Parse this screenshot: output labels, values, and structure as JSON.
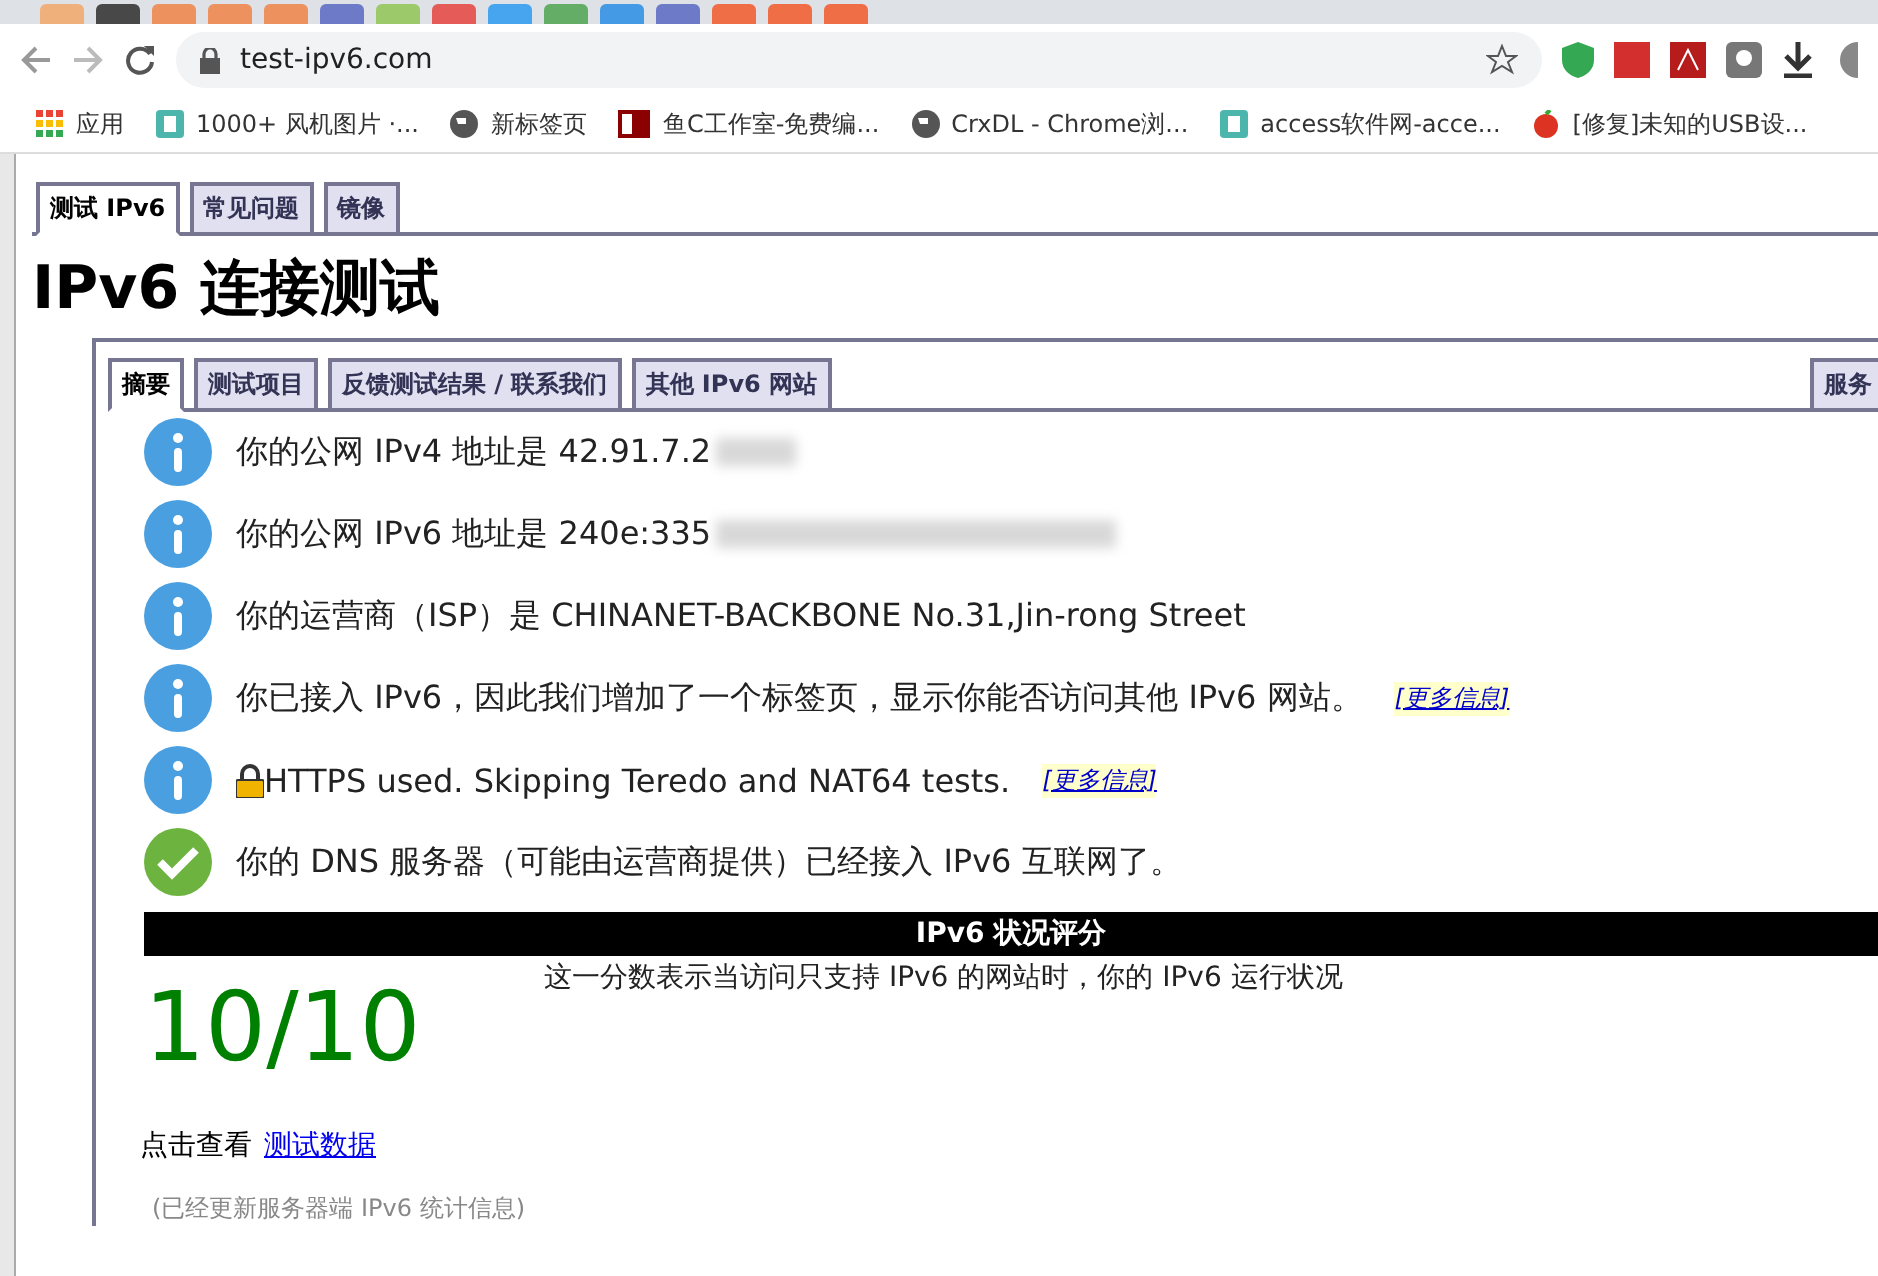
{
  "browser": {
    "url": "test-ipv6.com",
    "bookmarks": [
      {
        "label": "应用",
        "kind": "apps"
      },
      {
        "label": "1000+ 风机图片 ·...",
        "kind": "page"
      },
      {
        "label": "新标签页",
        "kind": "globe"
      },
      {
        "label": "鱼C工作室-免费编...",
        "kind": "fc"
      },
      {
        "label": "CrxDL - Chrome浏...",
        "kind": "globe"
      },
      {
        "label": "access软件网-acce...",
        "kind": "page"
      },
      {
        "label": "[修复]未知的USB设...",
        "kind": "apple"
      }
    ]
  },
  "site_tabs": [
    {
      "label": "测试 IPv6",
      "selected": true
    },
    {
      "label": "常见问题",
      "selected": false
    },
    {
      "label": "镜像",
      "selected": false
    }
  ],
  "heading": "IPv6 连接测试",
  "inner_tabs": [
    {
      "label": "摘要",
      "selected": true
    },
    {
      "label": "测试项目",
      "selected": false
    },
    {
      "label": "反馈测试结果 / 联系我们",
      "selected": false
    },
    {
      "label": "其他 IPv6 网站",
      "selected": false
    }
  ],
  "right_tab": "服务",
  "messages": [
    {
      "kind": "info",
      "text": "你的公网 IPv4 地址是 42.91.7.2",
      "blurred": true
    },
    {
      "kind": "info",
      "text": "你的公网 IPv6 地址是 240e:335",
      "blurred": true
    },
    {
      "kind": "info",
      "text": "你的运营商（ISP）是 CHINANET-BACKBONE No.31,Jin-rong Street"
    },
    {
      "kind": "info",
      "text": "你已接入 IPv6，因此我们增加了一个标签页，显示你能否访问其他 IPv6 网站。",
      "link": "[更多信息]"
    },
    {
      "kind": "info",
      "text": "HTTPS used. Skipping Teredo and NAT64 tests.",
      "link": "[更多信息]",
      "lock": true
    },
    {
      "kind": "ok",
      "text": "你的 DNS 服务器（可能由运营商提供）已经接入 IPv6 互联网了。"
    }
  ],
  "score": {
    "header": "IPv6 状况评分",
    "value": "10/10",
    "description": "这一分数表示当访问只支持 IPv6 的网站时，你的 IPv6 运行状况"
  },
  "details": {
    "prefix": "点击查看",
    "link": "测试数据"
  },
  "footnote": "(已经更新服务器端 IPv6 统计信息)"
}
